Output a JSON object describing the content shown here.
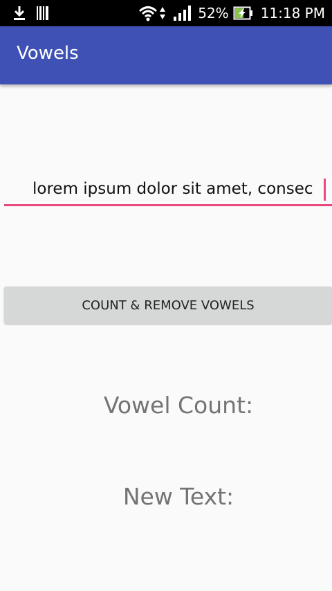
{
  "status_bar": {
    "battery_percent": "52%",
    "time": "11:18 PM",
    "icons": [
      "download-icon",
      "barcode-icon",
      "wifi-icon",
      "signal-icon",
      "battery-charging-icon"
    ]
  },
  "app_bar": {
    "title": "Vowels"
  },
  "input": {
    "value": "lorem ipsum dolor sit amet, consec"
  },
  "button": {
    "label": "COUNT & REMOVE VOWELS"
  },
  "results": {
    "vowel_count_label": "Vowel Count:",
    "new_text_label": "New Text:"
  },
  "colors": {
    "primary": "#3f51b5",
    "accent": "#e84a7f",
    "background": "#fafafa",
    "button_bg": "#d6d7d7",
    "result_text": "#737373",
    "battery_charge": "#8bc34a"
  }
}
